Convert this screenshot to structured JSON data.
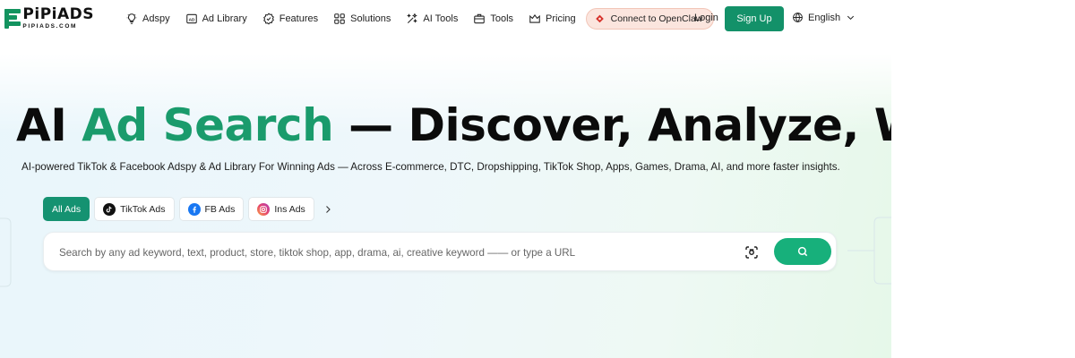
{
  "brand": {
    "name": "PiPiADS",
    "domain": "PIPIADS.COM",
    "colors": {
      "primary": "#139169",
      "accent_text": "#1a9b6c",
      "search_button": "#17b07b",
      "openclaw_bg": "#fbe5de"
    }
  },
  "nav": {
    "items": [
      {
        "label": "Adspy",
        "icon": "lightbulb-icon"
      },
      {
        "label": "Ad Library",
        "icon": "ad-icon"
      },
      {
        "label": "Features",
        "icon": "badge-check-icon"
      },
      {
        "label": "Solutions",
        "icon": "grid-icon"
      },
      {
        "label": "AI Tools",
        "icon": "ai-tools-icon"
      },
      {
        "label": "Tools",
        "icon": "toolbox-icon"
      },
      {
        "label": "Pricing",
        "icon": "crown-icon"
      }
    ],
    "openclaw_label": "Connect to OpenClaw",
    "login_label": "Login",
    "signup_label": "Sign Up",
    "language": "English"
  },
  "hero": {
    "title_part1": "AI ",
    "title_accent": "Ad Search",
    "title_part2": " — Discover, Analyze, Win",
    "subtitle": "AI-powered TikTok & Facebook Adspy & Ad Library For Winning Ads — Across E-commerce, DTC, Dropshipping, TikTok Shop, Apps, Games, Drama, AI, and more faster insights."
  },
  "tabs": [
    {
      "label": "All Ads",
      "active": true
    },
    {
      "label": "TikTok Ads",
      "icon": "tiktok-icon"
    },
    {
      "label": "FB Ads",
      "icon": "facebook-icon"
    },
    {
      "label": "Ins Ads",
      "icon": "instagram-icon"
    }
  ],
  "search": {
    "placeholder": "Search by any ad keyword, text, product, store, tiktok shop, app, drama, ai, creative keyword —— or type a URL",
    "value": ""
  }
}
